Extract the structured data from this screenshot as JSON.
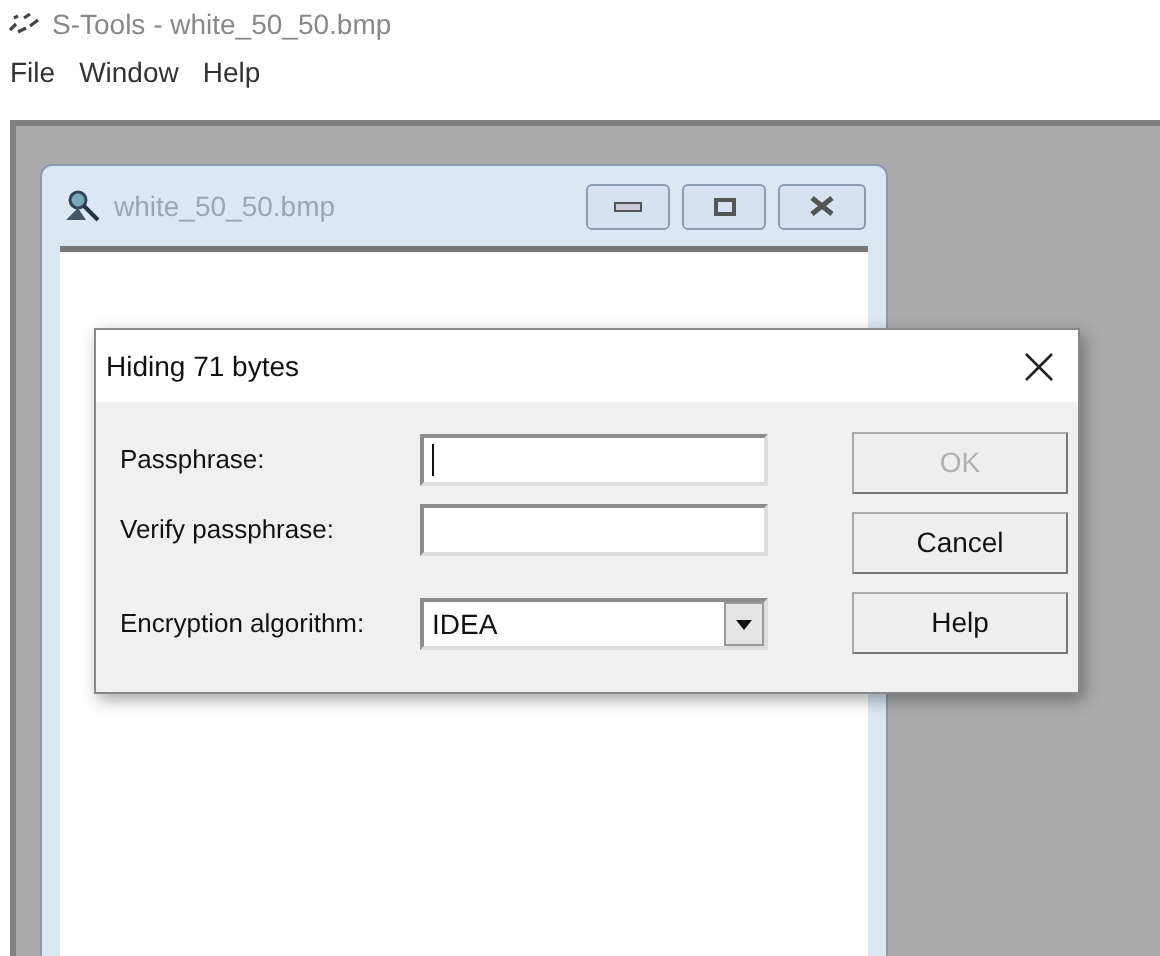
{
  "app": {
    "title": "S-Tools - white_50_50.bmp"
  },
  "menu": [
    "File",
    "Window",
    "Help"
  ],
  "child_window": {
    "title": "white_50_50.bmp"
  },
  "dialog": {
    "title": "Hiding 71 bytes",
    "fields": [
      {
        "label": "Passphrase:",
        "kind": "text",
        "focused": true
      },
      {
        "label": "Verify passphrase:",
        "kind": "text",
        "focused": false
      },
      {
        "label": "Encryption algorithm:",
        "kind": "select",
        "value": "IDEA"
      }
    ],
    "buttons": [
      {
        "label": "OK",
        "disabled": true
      },
      {
        "label": "Cancel",
        "disabled": false
      },
      {
        "label": "Help",
        "disabled": false
      }
    ]
  }
}
